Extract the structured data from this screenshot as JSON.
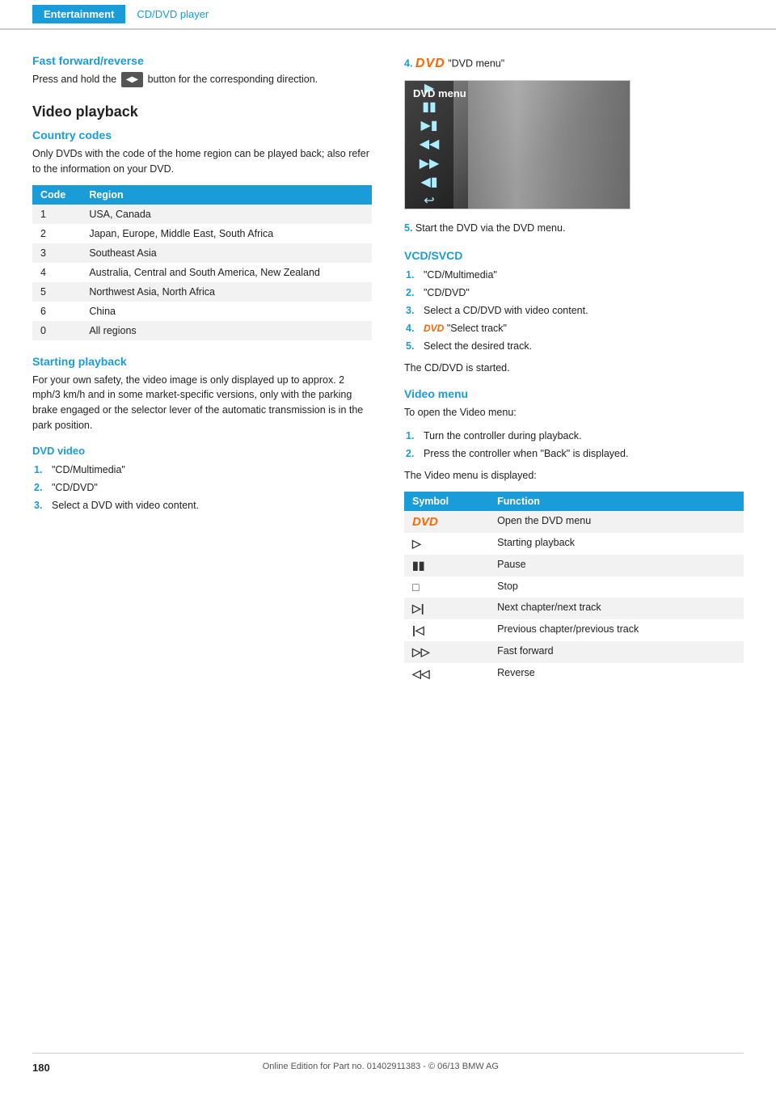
{
  "header": {
    "entertainment_label": "Entertainment",
    "section_label": "CD/DVD player"
  },
  "left": {
    "fast_forward_heading": "Fast forward/reverse",
    "fast_forward_text": "Press and hold the",
    "fast_forward_text2": "button for the corresponding direction.",
    "video_playback_heading": "Video playback",
    "country_codes_heading": "Country codes",
    "country_codes_desc": "Only DVDs with the code of the home region can be played back; also refer to the information on your DVD.",
    "table_headers": [
      "Code",
      "Region"
    ],
    "table_rows": [
      [
        "1",
        "USA, Canada"
      ],
      [
        "2",
        "Japan, Europe, Middle East, South Africa"
      ],
      [
        "3",
        "Southeast Asia"
      ],
      [
        "4",
        "Australia, Central and South America, New Zealand"
      ],
      [
        "5",
        "Northwest Asia, North Africa"
      ],
      [
        "6",
        "China"
      ],
      [
        "0",
        "All regions"
      ]
    ],
    "starting_playback_heading": "Starting playback",
    "starting_playback_desc": "For your own safety, the video image is only displayed up to approx. 2 mph/3 km/h and in some market-specific versions, only with the parking brake engaged or the selector lever of the automatic transmission is in the park position.",
    "dvd_video_label": "DVD video",
    "dvd_steps": [
      "\"CD/Multimedia\"",
      "\"CD/DVD\"",
      "Select a DVD with video content."
    ]
  },
  "right": {
    "step4_label": "\"DVD menu\"",
    "step5_text": "Start the DVD via the DVD menu.",
    "vcd_svcd_heading": "VCD/SVCD",
    "vcd_steps": [
      "\"CD/Multimedia\"",
      "\"CD/DVD\"",
      "Select a CD/DVD with video content.",
      "\"Select track\"",
      "Select the desired track."
    ],
    "vcd_note": "The CD/DVD is started.",
    "video_menu_heading": "Video menu",
    "video_menu_intro": "To open the Video menu:",
    "video_menu_steps": [
      "Turn the controller during playback.",
      "Press the controller when \"Back\" is displayed."
    ],
    "video_menu_note": "The Video menu is displayed:",
    "symbol_table_headers": [
      "Symbol",
      "Function"
    ],
    "symbol_table_rows": [
      [
        "DVD",
        "Open the DVD menu"
      ],
      [
        "▷",
        "Starting playback"
      ],
      [
        "II",
        "Pause"
      ],
      [
        "□",
        "Stop"
      ],
      [
        "⊳|",
        "Next chapter/next track"
      ],
      [
        "|⊲",
        "Previous chapter/previous track"
      ],
      [
        "▷▷",
        "Fast forward"
      ],
      [
        "◁◁",
        "Reverse"
      ]
    ]
  },
  "footer": {
    "page_number": "180",
    "copyright_text": "Online Edition for Part no. 01402911383 - © 06/13 BMW AG"
  }
}
